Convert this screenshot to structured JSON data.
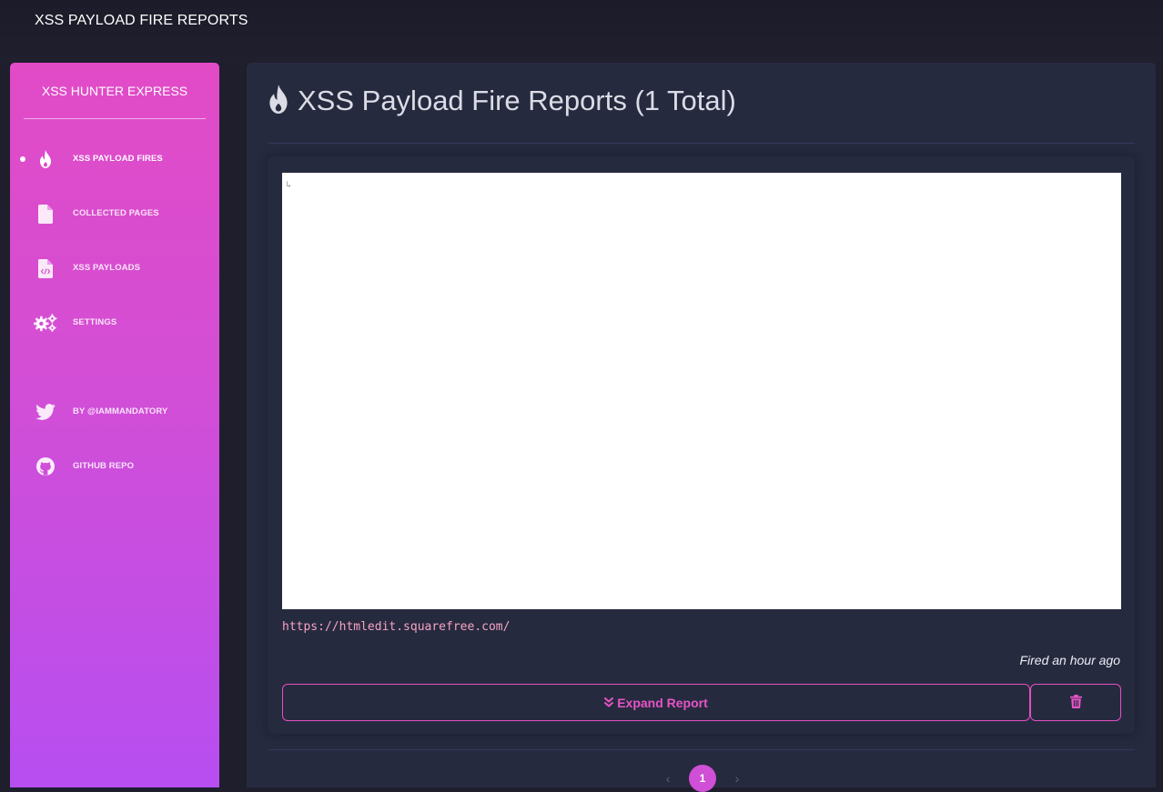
{
  "topbar": {
    "title": "XSS PAYLOAD FIRE REPORTS"
  },
  "sidebar": {
    "brand": "XSS HUNTER EXPRESS",
    "items": [
      {
        "label": "XSS PAYLOAD FIRES",
        "icon": "fire-icon",
        "active": true
      },
      {
        "label": "COLLECTED PAGES",
        "icon": "file-icon",
        "active": false
      },
      {
        "label": "XSS PAYLOADS",
        "icon": "file-code-icon",
        "active": false
      },
      {
        "label": "SETTINGS",
        "icon": "gears-icon",
        "active": false
      },
      {
        "label": "BY @IAMMANDATORY",
        "icon": "twitter-icon",
        "active": false
      },
      {
        "label": "GITHUB REPO",
        "icon": "github-icon",
        "active": false
      }
    ]
  },
  "main": {
    "title": "XSS Payload Fire Reports (1 Total)",
    "title_icon": "fire-icon",
    "report": {
      "url": "https://htmledit.squarefree.com/",
      "fired": "Fired an hour ago",
      "expand_label": "Expand Report",
      "delete_icon": "trash-icon"
    },
    "pagination": {
      "current": "1",
      "prev": "‹",
      "next": "›"
    }
  },
  "colors": {
    "accent": "#e24bc6",
    "sidebar_bottom": "#b74ef0",
    "panel": "#262a3f",
    "background": "#1e1e2d"
  }
}
